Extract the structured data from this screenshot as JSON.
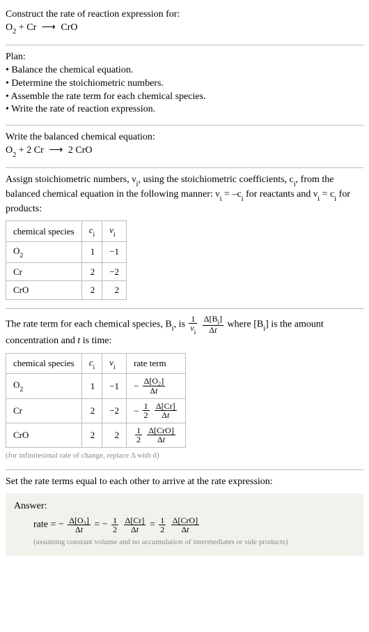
{
  "header": {
    "prompt": "Construct the rate of reaction expression for:",
    "eq_lhs1": "O",
    "eq_lhs1_sub": "2",
    "eq_plus": " + Cr ",
    "eq_arrow": "⟶",
    "eq_rhs": " CrO"
  },
  "plan": {
    "title": "Plan:",
    "items": [
      "Balance the chemical equation.",
      "Determine the stoichiometric numbers.",
      "Assemble the rate term for each chemical species.",
      "Write the rate of reaction expression."
    ]
  },
  "balanced": {
    "intro": "Write the balanced chemical equation:",
    "lhs1": "O",
    "lhs1_sub": "2",
    "plus": " + 2 Cr ",
    "arrow": "⟶",
    "rhs": " 2 CrO"
  },
  "stoich": {
    "intro_a": "Assign stoichiometric numbers, ν",
    "intro_a_sub": "i",
    "intro_b": ", using the stoichiometric coefficients, c",
    "intro_b_sub": "i",
    "intro_c": ", from the balanced chemical equation in the following manner: ν",
    "intro_c_sub": "i",
    "intro_d": " = –c",
    "intro_d_sub": "i",
    "intro_e": " for reactants and ν",
    "intro_e_sub": "i",
    "intro_f": " = c",
    "intro_f_sub": "i",
    "intro_g": " for products:",
    "headers": {
      "species": "chemical species",
      "c": "cᵢ",
      "v": "νᵢ"
    },
    "rows": [
      {
        "species_main": "O",
        "species_sub": "2",
        "c": "1",
        "v": "−1"
      },
      {
        "species_main": "Cr",
        "species_sub": "",
        "c": "2",
        "v": "−2"
      },
      {
        "species_main": "CrO",
        "species_sub": "",
        "c": "2",
        "v": "2"
      }
    ]
  },
  "rateterm": {
    "intro_a": "The rate term for each chemical species, B",
    "intro_a_sub": "i",
    "intro_b": ", is ",
    "frac1_num": "1",
    "frac1_den_a": "ν",
    "frac1_den_sub": "i",
    "frac2_num_a": "Δ[B",
    "frac2_num_sub": "i",
    "frac2_num_b": "]",
    "frac2_den": "Δt",
    "intro_c": " where [B",
    "intro_c_sub": "i",
    "intro_d": "] is the amount concentration and ",
    "intro_e": "t",
    "intro_f": " is time:",
    "headers": {
      "species": "chemical species",
      "c": "cᵢ",
      "v": "νᵢ",
      "rate": "rate term"
    },
    "rows": [
      {
        "species_main": "O",
        "species_sub": "2",
        "c": "1",
        "v": "−1",
        "rate_prefix": "−",
        "rate_coef_num": "",
        "rate_coef_den": "",
        "rate_num": "Δ[O₂]",
        "rate_den": "Δt"
      },
      {
        "species_main": "Cr",
        "species_sub": "",
        "c": "2",
        "v": "−2",
        "rate_prefix": "−",
        "rate_coef_num": "1",
        "rate_coef_den": "2",
        "rate_num": "Δ[Cr]",
        "rate_den": "Δt"
      },
      {
        "species_main": "CrO",
        "species_sub": "",
        "c": "2",
        "v": "2",
        "rate_prefix": "",
        "rate_coef_num": "1",
        "rate_coef_den": "2",
        "rate_num": "Δ[CrO]",
        "rate_den": "Δt"
      }
    ],
    "note": "(for infinitesimal rate of change, replace Δ with d)"
  },
  "final": {
    "intro": "Set the rate terms equal to each other to arrive at the rate expression:",
    "answer_label": "Answer:",
    "rate_label": "rate = ",
    "t1_prefix": "−",
    "t1_num": "Δ[O₂]",
    "t1_den": "Δt",
    "eq1": " = ",
    "t2_prefix": "−",
    "t2_cnum": "1",
    "t2_cden": "2",
    "t2_num": "Δ[Cr]",
    "t2_den": "Δt",
    "eq2": " = ",
    "t3_cnum": "1",
    "t3_cden": "2",
    "t3_num": "Δ[CrO]",
    "t3_den": "Δt",
    "note": "(assuming constant volume and no accumulation of intermediates or side products)"
  },
  "chart_data": {
    "type": "table",
    "tables": [
      {
        "title": "stoichiometric numbers",
        "columns": [
          "chemical species",
          "c_i",
          "nu_i"
        ],
        "rows": [
          [
            "O2",
            1,
            -1
          ],
          [
            "Cr",
            2,
            -2
          ],
          [
            "CrO",
            2,
            2
          ]
        ]
      },
      {
        "title": "rate terms",
        "columns": [
          "chemical species",
          "c_i",
          "nu_i",
          "rate term"
        ],
        "rows": [
          [
            "O2",
            1,
            -1,
            "-(Δ[O2]/Δt)"
          ],
          [
            "Cr",
            2,
            -2,
            "-(1/2)(Δ[Cr]/Δt)"
          ],
          [
            "CrO",
            2,
            2,
            "(1/2)(Δ[CrO]/Δt)"
          ]
        ]
      }
    ],
    "rate_expression": "rate = -(Δ[O2]/Δt) = -(1/2)(Δ[Cr]/Δt) = (1/2)(Δ[CrO]/Δt)"
  }
}
